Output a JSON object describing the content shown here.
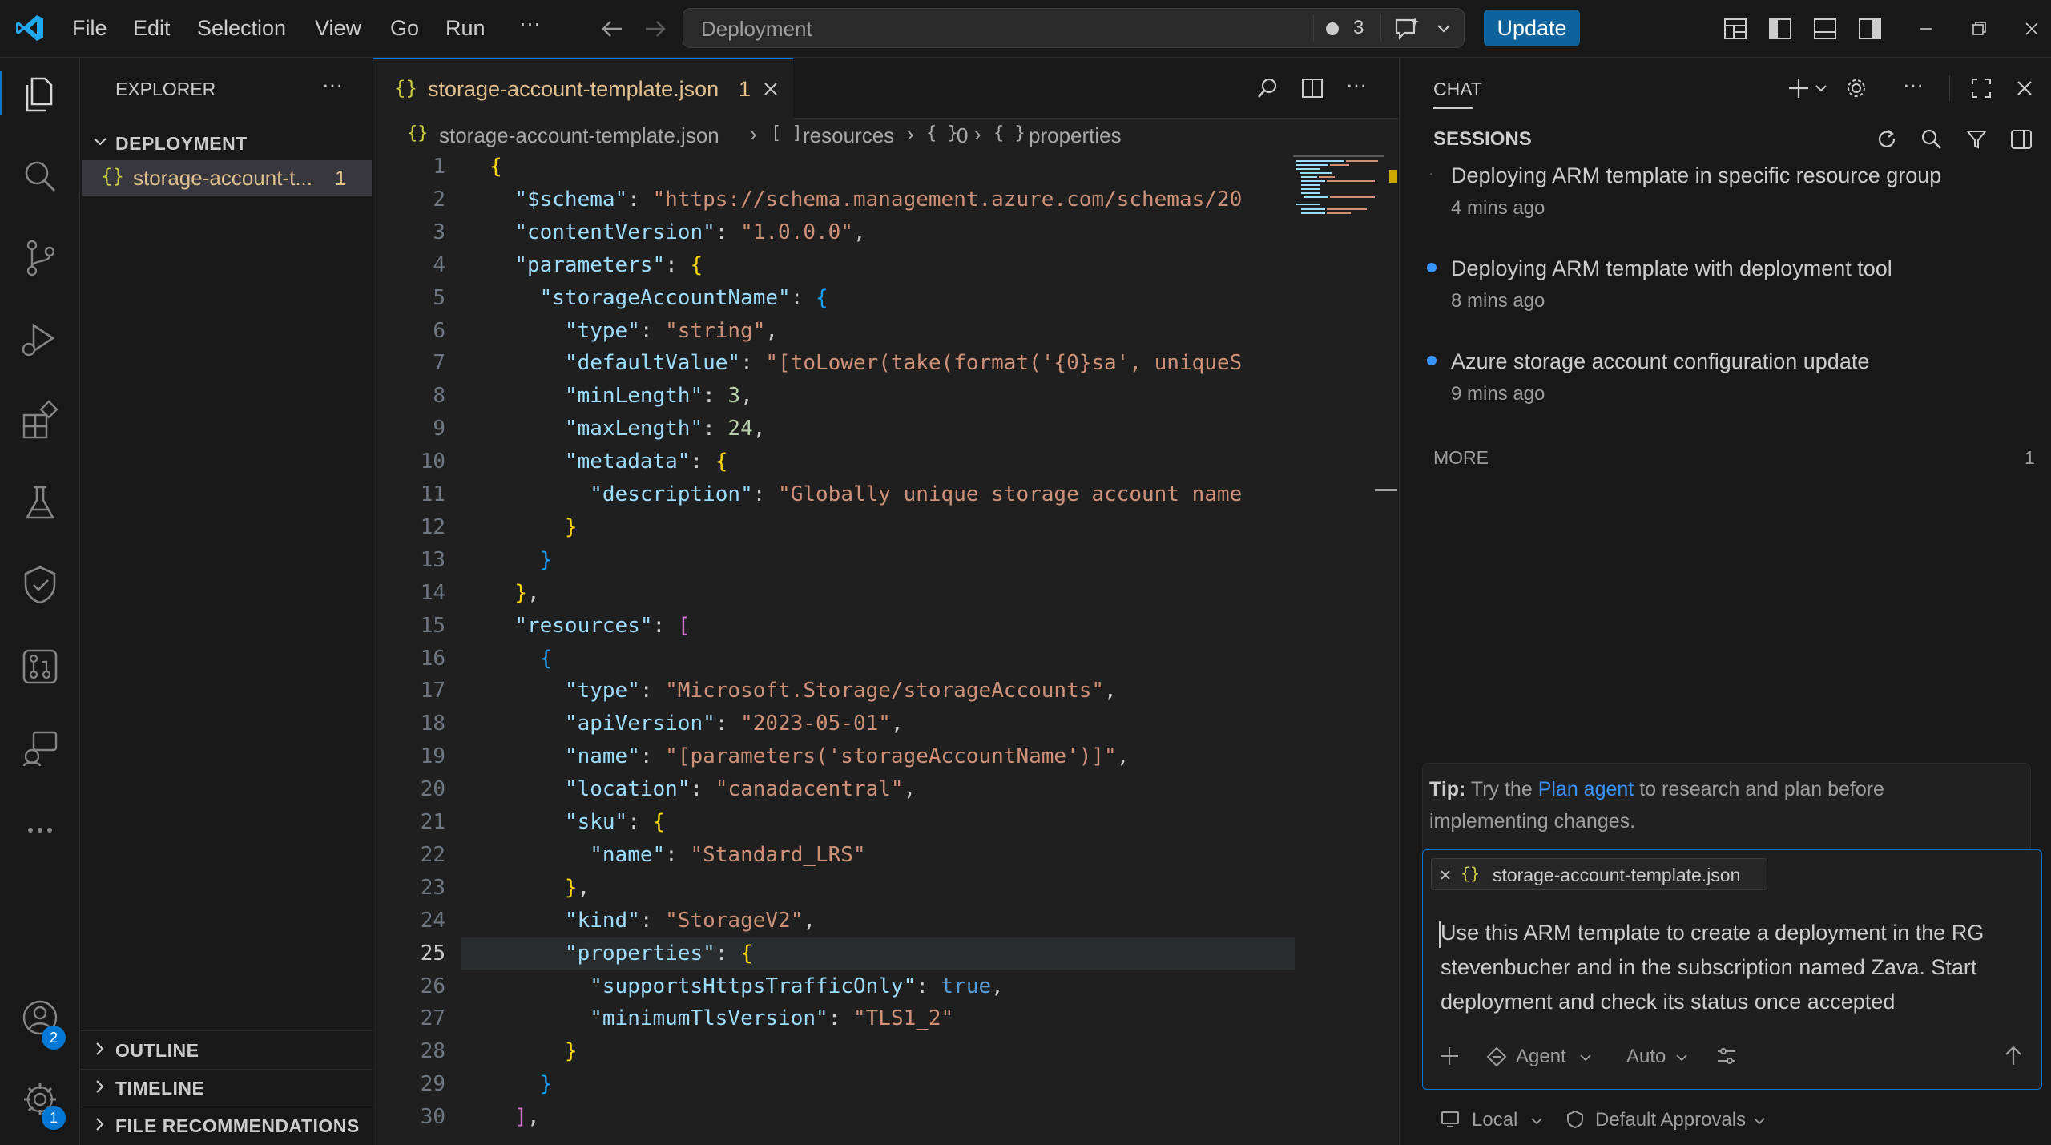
{
  "titlebar": {
    "menu": [
      "File",
      "Edit",
      "Selection",
      "View",
      "Go",
      "Run",
      "···"
    ],
    "search_placeholder": "Deployment",
    "problems_count": "3",
    "update_label": "Update"
  },
  "activitybar": {
    "accounts_badge": "2",
    "settings_badge": "1"
  },
  "sidebar": {
    "title": "EXPLORER",
    "folder": "DEPLOYMENT",
    "file": "storage-account-t...",
    "file_problems": "1",
    "sections": [
      "OUTLINE",
      "TIMELINE",
      "FILE RECOMMENDATIONS"
    ]
  },
  "editor": {
    "tab_label": "storage-account-template.json",
    "tab_problems": "1",
    "breadcrumb": [
      "storage-account-template.json",
      "resources",
      "0",
      "properties"
    ],
    "current_line": 25
  },
  "code_lines": [
    "{",
    "  \"$schema\": \"https://schema.management.azure.com/schemas/20",
    "  \"contentVersion\": \"1.0.0.0\",",
    "  \"parameters\": {",
    "    \"storageAccountName\": {",
    "      \"type\": \"string\",",
    "      \"defaultValue\": \"[toLower(take(format('{0}sa', uniqueS",
    "      \"minLength\": 3,",
    "      \"maxLength\": 24,",
    "      \"metadata\": {",
    "        \"description\": \"Globally unique storage account name",
    "      }",
    "    }",
    "  },",
    "  \"resources\": [",
    "    {",
    "      \"type\": \"Microsoft.Storage/storageAccounts\",",
    "      \"apiVersion\": \"2023-05-01\",",
    "      \"name\": \"[parameters('storageAccountName')]\",",
    "      \"location\": \"canadacentral\",",
    "      \"sku\": {",
    "        \"name\": \"Standard_LRS\"",
    "      },",
    "      \"kind\": \"StorageV2\",",
    "      \"properties\": {",
    "        \"supportsHttpsTrafficOnly\": true,",
    "        \"minimumTlsVersion\": \"TLS1_2\"",
    "      }",
    "    }",
    "  ],"
  ],
  "chat": {
    "title": "CHAT",
    "sessions_label": "SESSIONS",
    "sessions": [
      {
        "title": "Deploying ARM template in specific resource group",
        "time": "4 mins ago",
        "dot": false
      },
      {
        "title": "Deploying ARM template with deployment tool",
        "time": "8 mins ago",
        "dot": true
      },
      {
        "title": "Azure storage account configuration update",
        "time": "9 mins ago",
        "dot": true
      }
    ],
    "more_label": "MORE",
    "more_count": "1",
    "tip_bold": "Tip:",
    "tip_pre": "Try the",
    "tip_link": "Plan agent",
    "tip_post": "to research and plan before",
    "tip_line2": "implementing changes.",
    "attachment": "storage-account-template.json",
    "input_line1": "Use this ARM template to create a deployment in the RG",
    "input_line2": "stevenbucher and in the subscription named Zava. Start",
    "input_line3": "deployment and check its status once accepted",
    "mode": "Agent",
    "model": "Auto",
    "location": "Local",
    "approvals": "Default Approvals"
  },
  "colors": {
    "accent": "#0078d4",
    "key": "#9cdcfe",
    "string": "#ce9178",
    "number": "#b5cea8",
    "keyword": "#569cd6",
    "link": "#3794ff"
  }
}
